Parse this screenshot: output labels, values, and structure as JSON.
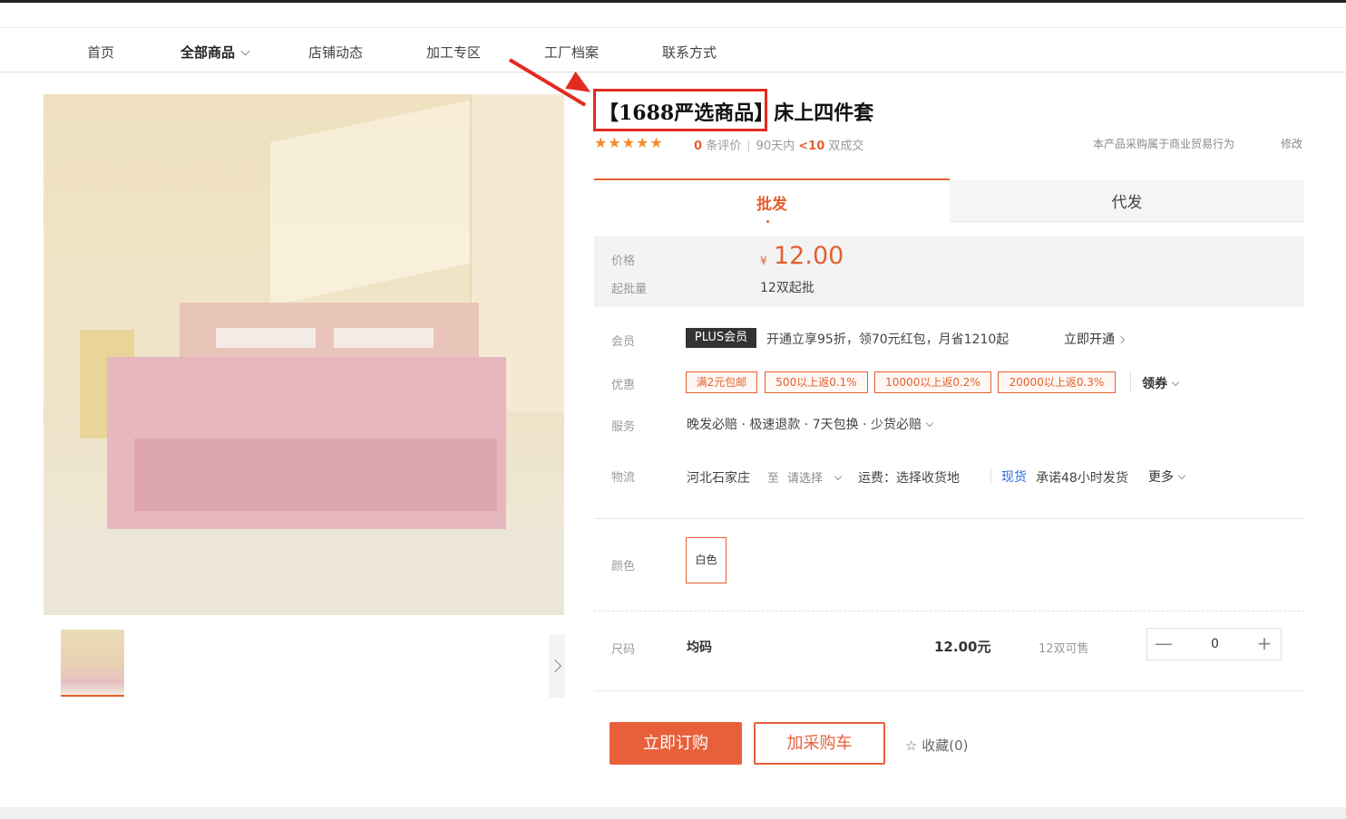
{
  "nav": {
    "items": [
      {
        "label": "首页"
      },
      {
        "label": "全部商品"
      },
      {
        "label": "店铺动态"
      },
      {
        "label": "加工专区"
      },
      {
        "label": "工厂档案"
      },
      {
        "label": "联系方式"
      }
    ]
  },
  "product": {
    "title": "【1688严选商品】床上四件套",
    "stars": "★★★★★",
    "review_count": "0",
    "review_label": "条评价",
    "sales_prefix": "90天内",
    "sales_value": "<10",
    "sales_suffix": "双成交",
    "trade_note": "本产品采购属于商业贸易行为",
    "edit_label": "修改"
  },
  "tabs": {
    "wholesale": "批发",
    "dropship": "代发"
  },
  "pricing": {
    "price_label": "价格",
    "currency_symbol": "¥",
    "price": "12.00",
    "moq_label": "起批量",
    "moq_value": "12双起批"
  },
  "membership": {
    "label": "会员",
    "badge": "PLUS会员",
    "text": "开通立享95折，领70元红包，月省1210起",
    "open_link": "立即开通"
  },
  "promotions": {
    "label": "优惠",
    "coupons": [
      "满2元包邮",
      "500以上返0.1%",
      "10000以上返0.2%",
      "20000以上返0.3%"
    ],
    "claim_label": "领券"
  },
  "services": {
    "label": "服务",
    "text": "晚发必赔 · 极速退款 · 7天包换 · 少货必赔"
  },
  "logistics": {
    "label": "物流",
    "origin": "河北石家庄",
    "to_label": "至",
    "destination_placeholder": "请选择",
    "fee_text": "运费：选择收货地",
    "stock_label": "现货",
    "promise_text": "承诺48小时发货",
    "more_label": "更多"
  },
  "color": {
    "label": "颜色",
    "selected": "白色"
  },
  "size": {
    "label": "尺码",
    "value": "均码",
    "price": "12.00元",
    "stock": "12双可售",
    "quantity": "0",
    "minus": "—",
    "plus": "+"
  },
  "actions": {
    "buy_now": "立即订购",
    "add_to_cart": "加采购车",
    "favorite": "收藏(0)",
    "favorite_icon": "☆"
  },
  "colors": {
    "accent": "#e4602e",
    "annotation": "#e32a1f",
    "link": "#2c6be0"
  }
}
